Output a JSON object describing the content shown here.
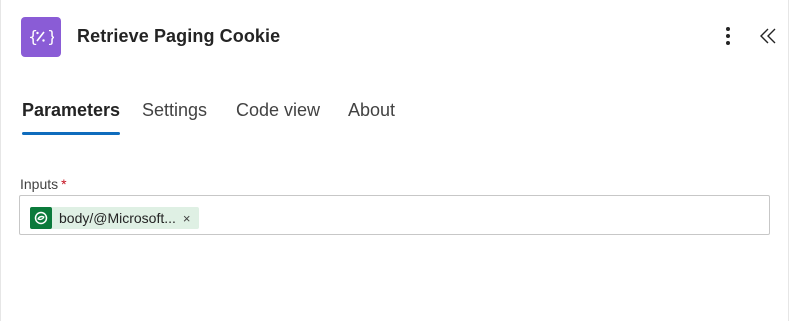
{
  "header": {
    "title": "Retrieve Paging Cookie",
    "icon": "variable-braces-icon",
    "accent_color": "#8a5cd6"
  },
  "tabs": [
    {
      "label": "Parameters",
      "active": true
    },
    {
      "label": "Settings",
      "active": false
    },
    {
      "label": "Code view",
      "active": false
    },
    {
      "label": "About",
      "active": false
    }
  ],
  "inputs_field": {
    "label": "Inputs",
    "required_marker": "*",
    "token": {
      "text": "body/@Microsoft...",
      "remove_glyph": "×",
      "icon": "dataverse-icon",
      "icon_color": "#0b7a3b"
    }
  },
  "colors": {
    "tab_underline": "#0f6cbd",
    "required": "#c50f1f"
  }
}
